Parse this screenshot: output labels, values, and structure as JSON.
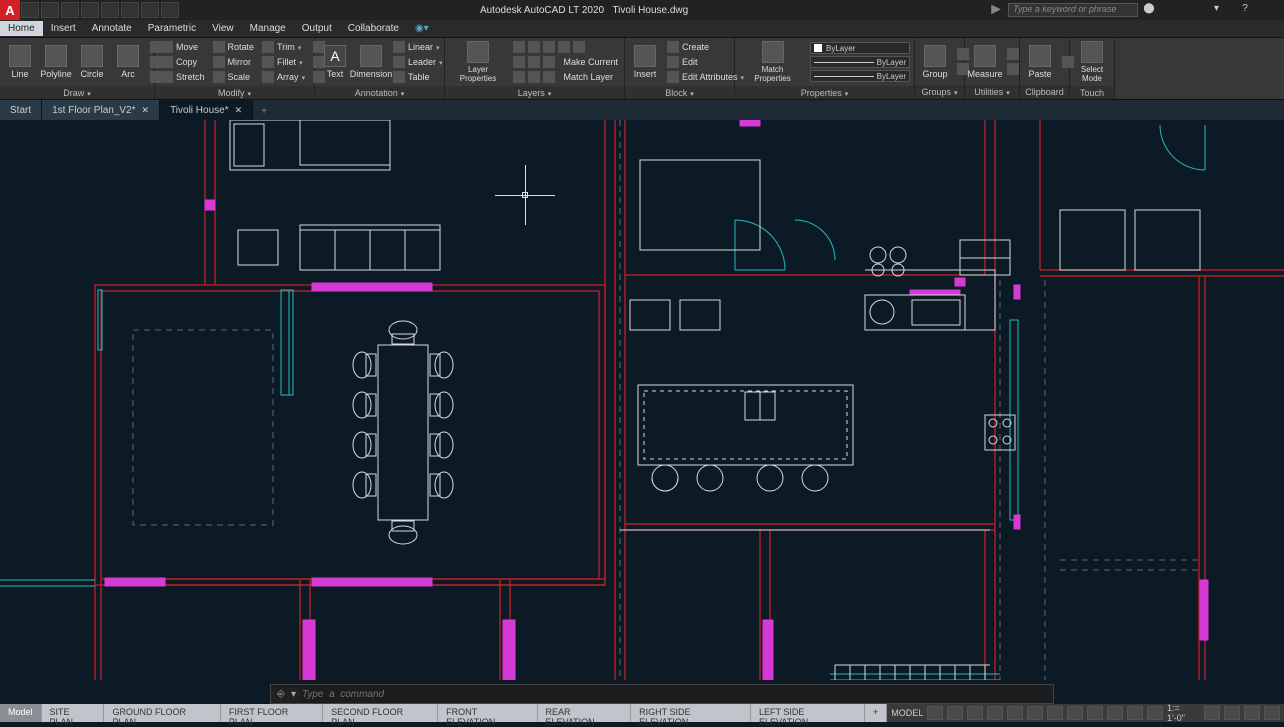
{
  "app": {
    "title_prefix": "Autodesk AutoCAD LT 2020",
    "title_file": "Tivoli House.dwg",
    "search_placeholder": "Type a keyword or phrase"
  },
  "menubar": [
    "Home",
    "Insert",
    "Annotate",
    "Parametric",
    "View",
    "Manage",
    "Output",
    "Collaborate"
  ],
  "menubar_active": 0,
  "ribbon": {
    "draw": {
      "label": "Draw",
      "items": [
        "Line",
        "Polyline",
        "Circle",
        "Arc"
      ]
    },
    "modify": {
      "label": "Modify",
      "rows": [
        [
          "Move",
          "Rotate",
          "Trim"
        ],
        [
          "Copy",
          "Mirror",
          "Fillet"
        ],
        [
          "Stretch",
          "Scale",
          "Array"
        ]
      ]
    },
    "annotation": {
      "label": "Annotation",
      "big": [
        "Text",
        "Dimension"
      ],
      "rows": [
        "Linear",
        "Leader",
        "Table"
      ]
    },
    "layers": {
      "label": "Layers",
      "big": "Layer Properties",
      "rows": [
        "Make Current",
        "Match Layer"
      ]
    },
    "block": {
      "label": "Block",
      "big": "Insert",
      "rows": [
        "Create",
        "Edit",
        "Edit Attributes"
      ]
    },
    "properties": {
      "label": "Properties",
      "big": "Match Properties",
      "layer_combo": "ByLayer",
      "line1": "ByLayer",
      "line2": "ByLayer"
    },
    "groups": {
      "label": "Groups",
      "big": "Group"
    },
    "utilities": {
      "label": "Utilities",
      "big": "Measure"
    },
    "clipboard": {
      "label": "Clipboard",
      "big": "Paste"
    },
    "touch": {
      "label": "Touch",
      "big": "Select Mode"
    }
  },
  "filetabs": {
    "items": [
      {
        "label": "Start",
        "close": false
      },
      {
        "label": "1st Floor Plan_V2*",
        "close": true
      },
      {
        "label": "Tivoli House*",
        "close": true
      }
    ],
    "active": 2
  },
  "command_placeholder": "Type  a  command",
  "layouts": {
    "items": [
      "Model",
      "SITE PLAN",
      "GROUND FLOOR PLAN",
      "FIRST FLOOR PLAN",
      "SECOND FLOOR PLAN",
      "FRONT  ELEVATION",
      "REAR  ELEVATION",
      "RIGHT SIDE ELEVATION",
      "LEFT SIDE  ELEVATION"
    ],
    "active": 0
  },
  "status": {
    "mode": "MODEL",
    "zoom": "1:= 1'-0\""
  },
  "colors": {
    "wall": "#d02028",
    "accent": "#d63ad6",
    "glass": "#1fbdbd",
    "line": "#d8d8d8",
    "dash": "#5a6b78"
  }
}
